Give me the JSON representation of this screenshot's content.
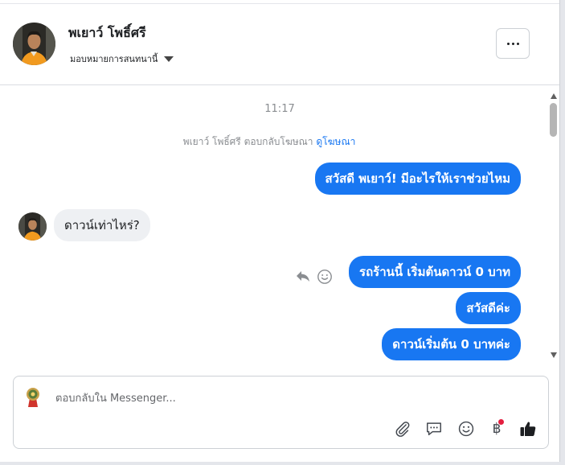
{
  "header": {
    "name": "พเยาว์ โพธิ์ศรี",
    "assign_label": "มอบหมายการสนทนานี้"
  },
  "conversation": {
    "timestamp": "11:17",
    "notice_text": "พเยาว์ โพธิ์ศรี ตอบกลับโฆษณา",
    "notice_link": "ดูโฆษณา",
    "messages": [
      {
        "direction": "outgoing",
        "text": "สวัสดี พเยาว์! มีอะไรให้เราช่วยไหม"
      },
      {
        "direction": "incoming",
        "text": "ดาวน์เท่าไหร่?"
      },
      {
        "direction": "outgoing",
        "text": "รถร้านนี้ เริ่มต้นดาวน์ 0 บาท"
      },
      {
        "direction": "outgoing",
        "text": "สวัสดีค่ะ"
      },
      {
        "direction": "outgoing",
        "text": "ดาวน์เริ่มต้น 0 บาทค่ะ"
      }
    ]
  },
  "composer": {
    "placeholder": "ตอบกลับใน Messenger...",
    "tools": [
      "attachment-icon",
      "saved-reply-icon",
      "emoji-icon",
      "payment-icon",
      "like-icon"
    ],
    "notification_dot_color": "#e41e3f"
  },
  "colors": {
    "accent": "#1877f2",
    "incoming_bubble": "#eef0f3",
    "muted_text": "#8a8d91"
  }
}
